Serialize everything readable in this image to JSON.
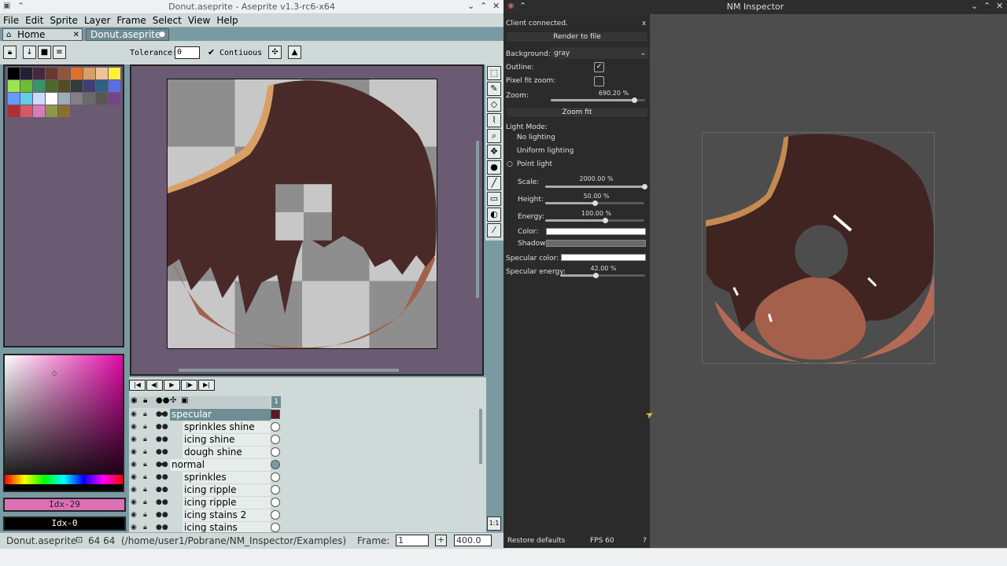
{
  "aseprite": {
    "window_title": "Donut.aseprite - Aseprite v1.3-rc6-x64",
    "menu": [
      "File",
      "Edit",
      "Sprite",
      "Layer",
      "Frame",
      "Select",
      "View",
      "Help"
    ],
    "tabs": {
      "home": "Home",
      "doc": "Donut.aseprite"
    },
    "toolbar": {
      "tolerance_label": "Tolerance:",
      "tolerance_value": "0",
      "contiguous_label": "Contiuous",
      "contiguous_checked": true
    },
    "palette_colors": [
      "#000000",
      "#222034",
      "#45283c",
      "#663931",
      "#8f563b",
      "#df7126",
      "#d9a066",
      "#eec39a",
      "#fbf236",
      "#99e550",
      "#6abe30",
      "#37946e",
      "#4b692f",
      "#524b24",
      "#323c39",
      "#3f3f74",
      "#306082",
      "#5b6ee1",
      "#639bff",
      "#5fcde4",
      "#cbdbfc",
      "#ffffff",
      "#9badb7",
      "#847e87",
      "#696a6a",
      "#595652",
      "#76428a",
      "#ac3232",
      "#d95763",
      "#d77bba",
      "#8f974a",
      "#8a6f30"
    ],
    "color_indices": {
      "fg": "Idx-29",
      "bg": "Idx-0"
    },
    "layers": [
      {
        "name": "specular",
        "group": true,
        "selected": true
      },
      {
        "name": "sprinkles shine",
        "group": false
      },
      {
        "name": "icing shine",
        "group": false
      },
      {
        "name": "dough shine",
        "group": false
      },
      {
        "name": "normal",
        "group": true
      },
      {
        "name": "sprinkles",
        "group": false
      },
      {
        "name": "icing ripple",
        "group": false
      },
      {
        "name": "icing ripple",
        "group": false
      },
      {
        "name": "icing stains 2",
        "group": false
      },
      {
        "name": "icing stains",
        "group": false
      }
    ],
    "frame_number_header": "1",
    "status": {
      "file": "Donut.aseprite",
      "size": "64 64",
      "path": "(/home/user1/Pobrane/NM_Inspector/Examples)",
      "frame_label": "Frame:",
      "frame_value": "1",
      "zoom_value": "400.0"
    },
    "canvas_bg": "#6a5a72"
  },
  "inspector": {
    "window_title": "NM Inspector",
    "client_status": "Client connected.",
    "close_x": "x",
    "render_button": "Render to file",
    "background_label": "Background:",
    "background_value": "gray",
    "outline_label": "Outline:",
    "outline_checked": true,
    "pixel_fit_label": "Pixel fit zoom:",
    "pixel_fit_checked": false,
    "zoom_label": "Zoom:",
    "zoom_value": "690.20 %",
    "zoom_fraction": 0.88,
    "zoom_fit_button": "Zoom fit",
    "light_mode_label": "Light Mode:",
    "light_modes": [
      "No lighting",
      "Uniform lighting",
      "Point light"
    ],
    "light_mode_selected": "Point light",
    "scale_label": "Scale:",
    "scale_value": "2000.00 %",
    "scale_fraction": 1.0,
    "height_label": "Height:",
    "height_value": "50.00 %",
    "height_fraction": 0.5,
    "energy_label": "Energy:",
    "energy_value": "100.00 %",
    "energy_fraction": 0.6,
    "color_label": "Color:",
    "color_value": "#ffffff",
    "shadow_label": "Shadow:",
    "shadow_value": "#6a6a6a",
    "specular_color_label": "Specular color:",
    "specular_color_value": "#ffffff",
    "specular_energy_label": "Specular energy:",
    "specular_energy_value": "42.00 %",
    "specular_energy_fraction": 0.42,
    "restore_button": "Restore defaults",
    "fps": "FPS 60",
    "help": "?"
  }
}
